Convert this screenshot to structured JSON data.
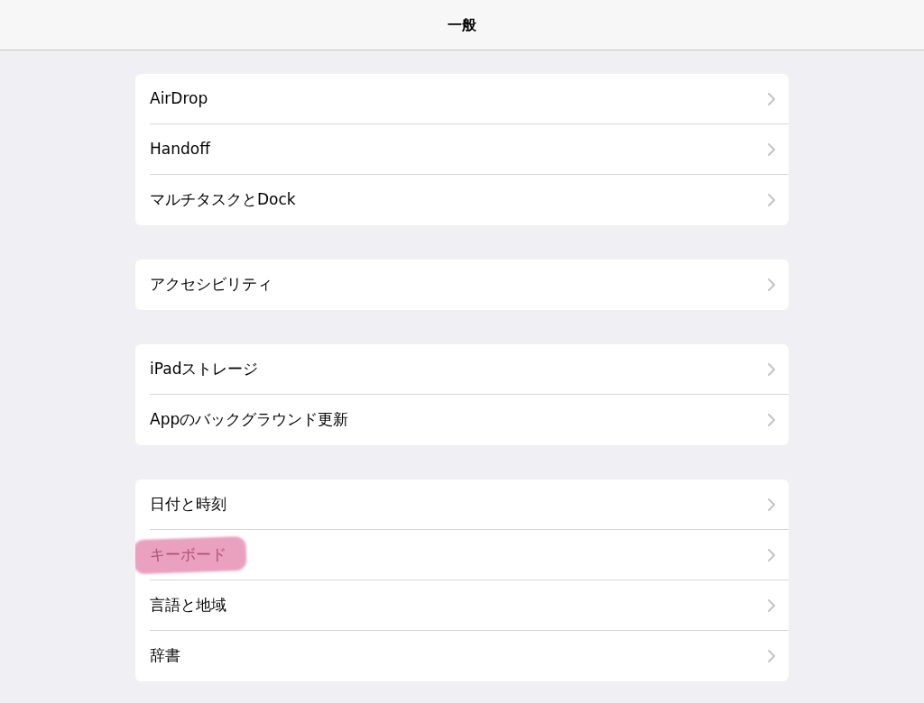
{
  "header": {
    "title": "一般"
  },
  "groups": [
    {
      "items": [
        {
          "label": "AirDrop",
          "highlighted": false
        },
        {
          "label": "Handoff",
          "highlighted": false
        },
        {
          "label": "マルチタスクとDock",
          "highlighted": false
        }
      ]
    },
    {
      "items": [
        {
          "label": "アクセシビリティ",
          "highlighted": false
        }
      ]
    },
    {
      "items": [
        {
          "label": "iPadストレージ",
          "highlighted": false
        },
        {
          "label": "Appのバックグラウンド更新",
          "highlighted": false
        }
      ]
    },
    {
      "items": [
        {
          "label": "日付と時刻",
          "highlighted": false
        },
        {
          "label": "キーボード",
          "highlighted": true
        },
        {
          "label": "言語と地域",
          "highlighted": false
        },
        {
          "label": "辞書",
          "highlighted": false
        }
      ]
    }
  ]
}
